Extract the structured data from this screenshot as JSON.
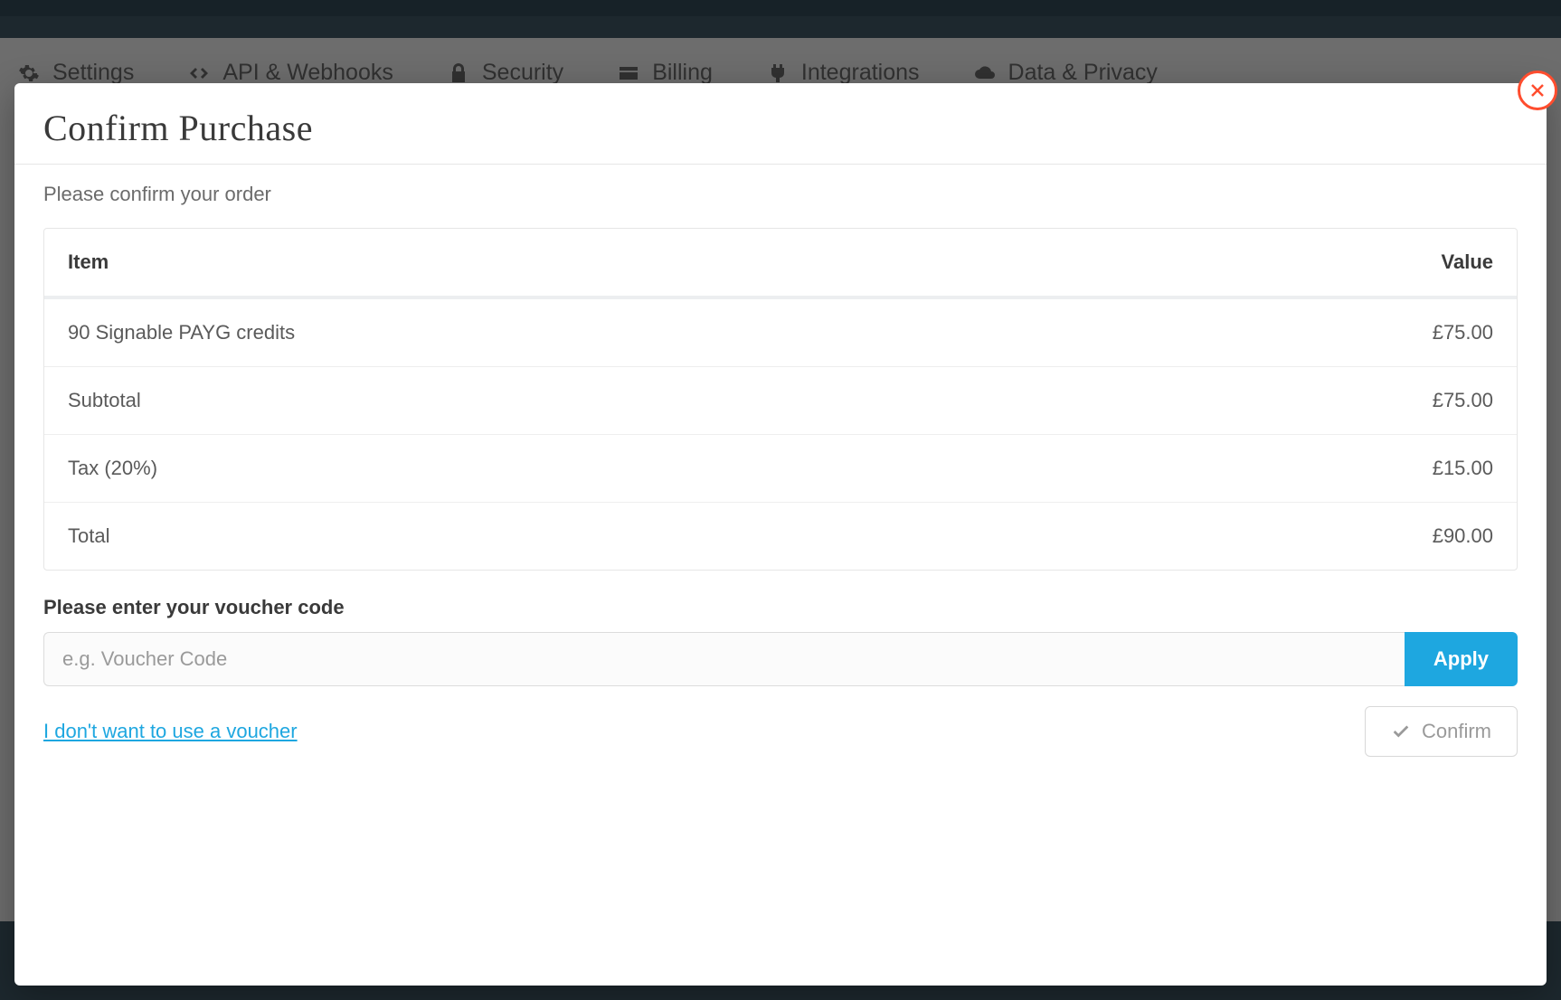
{
  "nav": {
    "tabs": [
      {
        "label": "Settings",
        "icon": "gear-icon"
      },
      {
        "label": "API & Webhooks",
        "icon": "code-icon"
      },
      {
        "label": "Security",
        "icon": "lock-icon"
      },
      {
        "label": "Billing",
        "icon": "card-icon"
      },
      {
        "label": "Integrations",
        "icon": "plug-icon"
      },
      {
        "label": "Data & Privacy",
        "icon": "cloud-icon"
      }
    ]
  },
  "modal": {
    "title": "Confirm Purchase",
    "subtitle": "Please confirm your order",
    "close_label": "Close",
    "table": {
      "header_item": "Item",
      "header_value": "Value",
      "rows": [
        {
          "item": "90 Signable PAYG credits",
          "value": "£75.00"
        },
        {
          "item": "Subtotal",
          "value": "£75.00"
        },
        {
          "item": "Tax (20%)",
          "value": "£15.00"
        },
        {
          "item": "Total",
          "value": "£90.00"
        }
      ]
    },
    "voucher": {
      "label": "Please enter your voucher code",
      "placeholder": "e.g. Voucher Code",
      "apply_label": "Apply",
      "skip_link": "I don't want to use a voucher"
    },
    "confirm_label": "Confirm"
  }
}
